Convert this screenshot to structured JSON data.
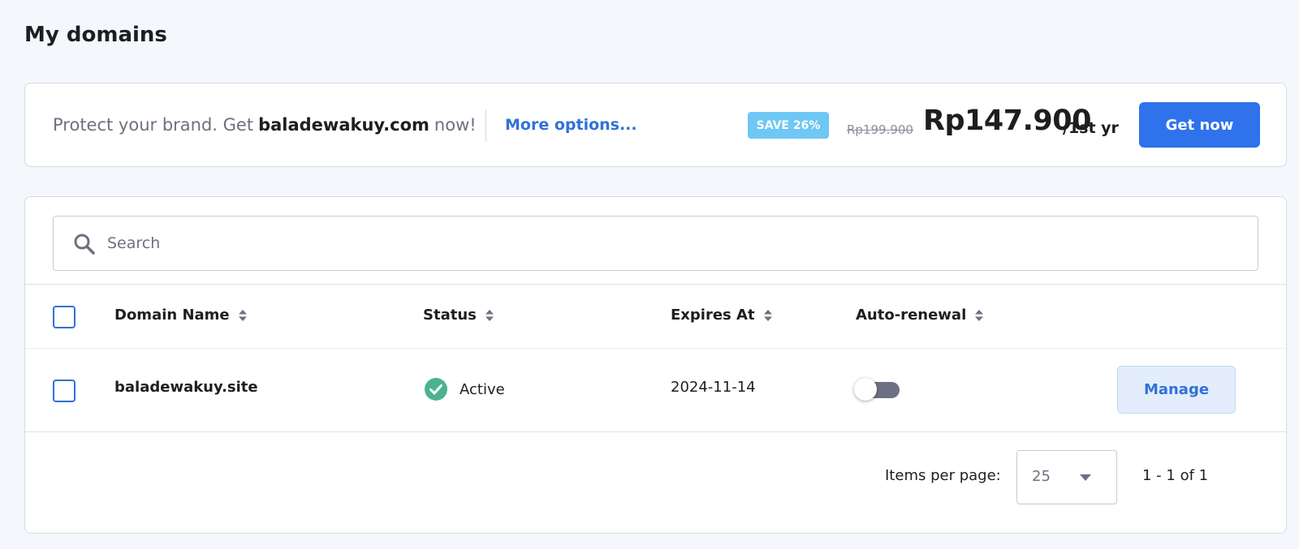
{
  "page": {
    "title": "My domains"
  },
  "promo": {
    "text_before": "Protect your brand. Get",
    "domain": "baladewakuy.com",
    "text_after": "now!",
    "more_options": "More options...",
    "save_badge": "SAVE 26%",
    "old_price": "Rp199.900",
    "new_price": "Rp147.900",
    "period": "/1st yr",
    "cta_label": "Get now"
  },
  "search": {
    "placeholder": "Search",
    "icon": "search-icon"
  },
  "table": {
    "headers": {
      "domain_name": "Domain Name",
      "status": "Status",
      "expires_at": "Expires At",
      "auto_renewal": "Auto-renewal"
    },
    "rows": [
      {
        "domain": "baladewakuy.site",
        "status": "Active",
        "status_icon": "check-circle-icon",
        "expires": "2024-11-14",
        "auto_renewal": false,
        "action": "Manage"
      }
    ]
  },
  "pagination": {
    "items_per_page_label": "Items per page:",
    "items_per_page": "25",
    "range": "1 - 1 of 1"
  },
  "colors": {
    "accent": "#2f72ec",
    "link": "#3171d8",
    "badge": "#6ec7f4",
    "success": "#00b090",
    "toggle_off": "#6d7081"
  }
}
